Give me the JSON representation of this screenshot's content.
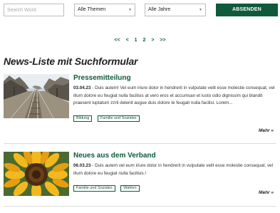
{
  "filters": {
    "search_placeholder": "Search Word",
    "themes_select": "Alle Themen",
    "years_select": "Alle Jahre",
    "submit_label": "ABSENDEN"
  },
  "pagination": {
    "first": "<<",
    "prev": "<",
    "pages": [
      "1",
      "2"
    ],
    "next": ">",
    "last": ">>",
    "current_page": "2"
  },
  "page_title": "News-Liste mit Suchformular",
  "news": [
    {
      "title": "Pressemitteilung",
      "date": "03.04.23",
      "text": " - Duis autem! Vel eum iriure dolor in hendrerit in vulputate velit esse molestie consequat, vel illum dolore eu feugiat nulla facilisis at vero eros et accumsan et iusto odio dignissim qui blandit praesent luptatum zzril delenit augue duis dolore te feugait nulla facilisi. Lorem...",
      "tags": [
        "Bildung",
        "Familie und Soziales"
      ],
      "more_label": "Mehr »",
      "image": "railway-tracks-photo"
    },
    {
      "title": "Neues aus dem Verband",
      "date": "06.03.23",
      "text": " - Duis autem vel eum iriure dolor in hendrerit in vulputate velit esse molestie consequat, vel illum dolore eu feugiat nulla facilisis.!",
      "tags": [
        "Familie und Soziales",
        "Wahlen"
      ],
      "more_label": "Mehr »",
      "image": "sunflower-photo"
    }
  ],
  "colors": {
    "brand_green": "#0f5a3b"
  }
}
